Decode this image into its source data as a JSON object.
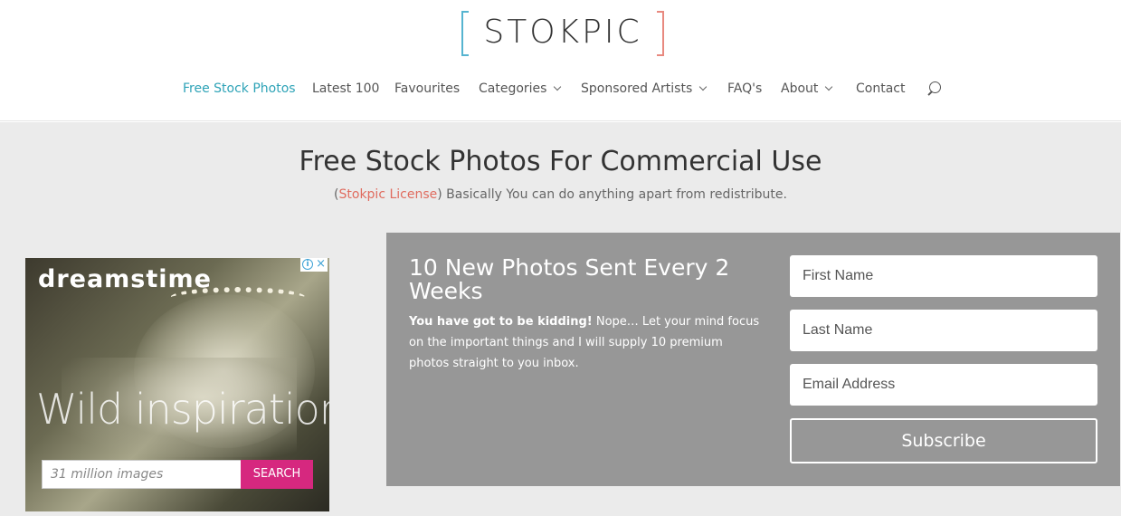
{
  "header": {
    "logo_text": "STOKPIC",
    "nav": [
      {
        "label": "Free Stock Photos",
        "dropdown": false
      },
      {
        "label": "Latest 100",
        "dropdown": false
      },
      {
        "label": "Favourites",
        "dropdown": false
      },
      {
        "label": "Categories",
        "dropdown": true
      },
      {
        "label": "Sponsored Artists",
        "dropdown": true
      },
      {
        "label": "FAQ's",
        "dropdown": false
      },
      {
        "label": "About",
        "dropdown": true
      },
      {
        "label": "Contact",
        "dropdown": false
      }
    ],
    "search_icon": "search-icon",
    "active_color": "#2ea3b7"
  },
  "hero": {
    "title": "Free Stock Photos For Commercial Use",
    "sub_open": "(",
    "sub_link": "Stokpic License",
    "sub_rest": ") Basically You can do anything apart from redistribute."
  },
  "ad": {
    "brand": "dreamstime",
    "tagline": "Wild inspiration",
    "search_placeholder": "31 million images",
    "search_button": "SEARCH",
    "info_icon": "i",
    "close_icon": "×"
  },
  "signup": {
    "title": "10 New Photos Sent Every 2 Weeks",
    "text_bold": "You have got to be kidding!",
    "text_rest": " Nope… Let your mind focus on the important things and I will supply 10 premium photos straight to you inbox.",
    "first_name_placeholder": "First Name",
    "last_name_placeholder": "Last Name",
    "email_placeholder": "Email Address",
    "subscribe_label": "Subscribe",
    "background": "#979797"
  }
}
